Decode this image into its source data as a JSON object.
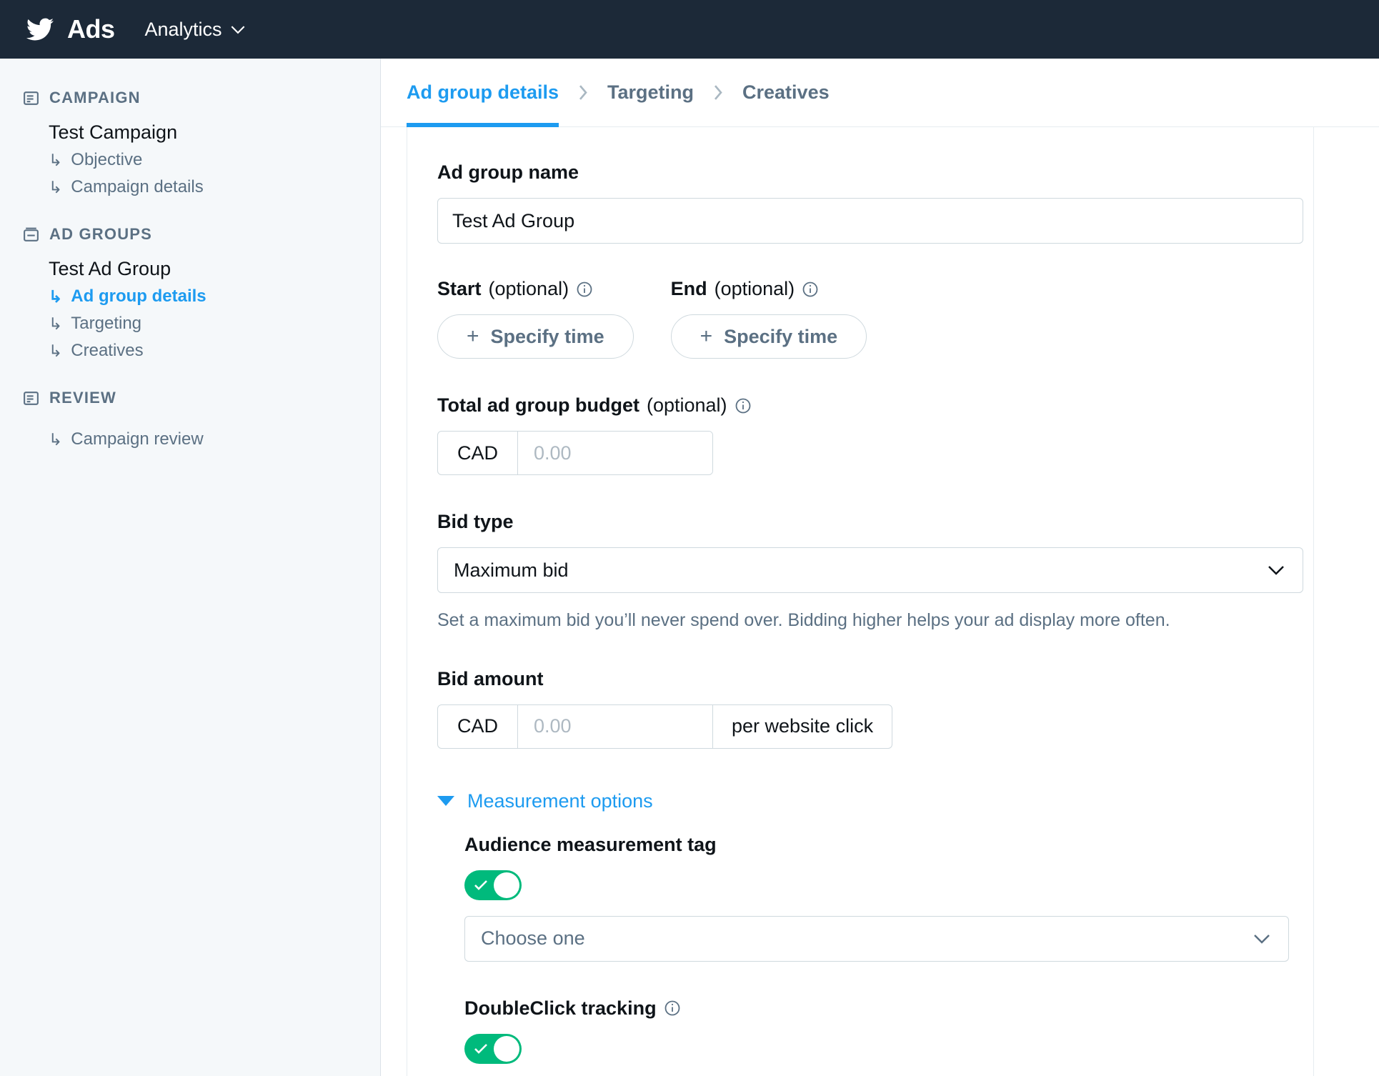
{
  "header": {
    "logo_name": "twitter-bird-logo",
    "brand": "Ads",
    "nav_label": "Analytics"
  },
  "sidebar": {
    "sections": [
      {
        "title": "CAMPAIGN",
        "entity": "Test Campaign",
        "items": [
          {
            "label": "Objective",
            "active": false
          },
          {
            "label": "Campaign details",
            "active": false
          }
        ]
      },
      {
        "title": "AD GROUPS",
        "entity": "Test Ad Group",
        "items": [
          {
            "label": "Ad group details",
            "active": true
          },
          {
            "label": "Targeting",
            "active": false
          },
          {
            "label": "Creatives",
            "active": false
          }
        ]
      },
      {
        "title": "REVIEW",
        "entity": "",
        "items": [
          {
            "label": "Campaign review",
            "active": false
          }
        ]
      }
    ],
    "arrow_glyph": "↳"
  },
  "tabs": [
    {
      "label": "Ad group details",
      "active": true
    },
    {
      "label": "Targeting",
      "active": false
    },
    {
      "label": "Creatives",
      "active": false
    }
  ],
  "form": {
    "ad_group_name": {
      "label": "Ad group name",
      "value": "Test Ad Group"
    },
    "start": {
      "label": "Start",
      "optional": "(optional)",
      "button": "Specify time",
      "plus": "+"
    },
    "end": {
      "label": "End",
      "optional": "(optional)",
      "button": "Specify time",
      "plus": "+"
    },
    "budget": {
      "label": "Total ad group budget",
      "optional": "(optional)",
      "currency": "CAD",
      "placeholder": "0.00",
      "value": ""
    },
    "bid_type": {
      "label": "Bid type",
      "value": "Maximum bid",
      "help": "Set a maximum bid you’ll never spend over. Bidding higher helps your ad display more often."
    },
    "bid_amount": {
      "label": "Bid amount",
      "currency": "CAD",
      "placeholder": "0.00",
      "value": "",
      "unit": "per website click"
    },
    "measurement": {
      "disclosure_label": "Measurement options",
      "audience_tag": {
        "label": "Audience measurement tag",
        "toggle_on": true,
        "select_value": "Choose one"
      },
      "doubleclick": {
        "label": "DoubleClick tracking",
        "toggle_on": true
      }
    }
  },
  "colors": {
    "brand_blue": "#1d9bf0",
    "header_bg": "#1c2938",
    "sidebar_bg": "#f5f8fa",
    "toggle_green": "#00ba7c",
    "muted_text": "#5b7083"
  }
}
